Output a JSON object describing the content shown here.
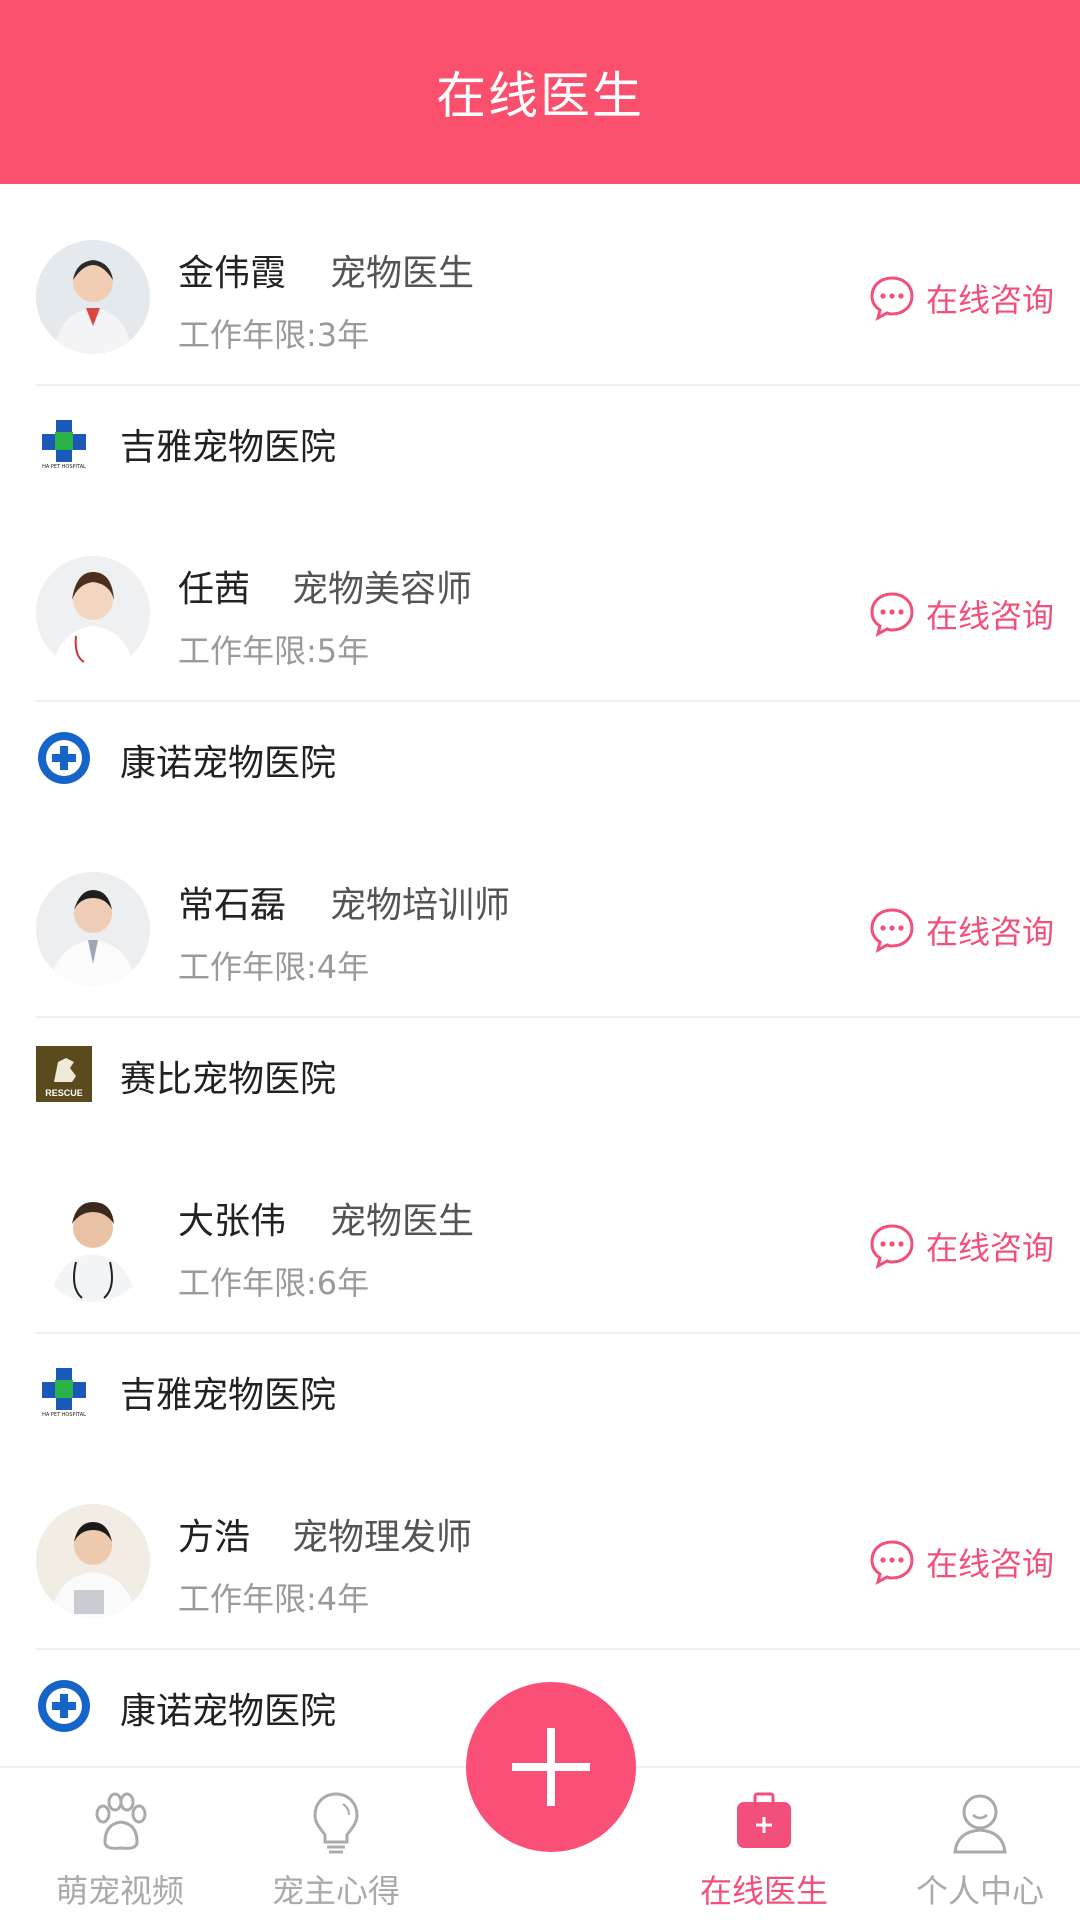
{
  "header": {
    "title": "在线医生"
  },
  "doctors": [
    {
      "name": "金伟霞",
      "role": "宠物医生",
      "years": "工作年限:3年",
      "consult_label": "在线咨询",
      "hospital": "吉雅宠物医院",
      "hospital_logo": "jiya-logo-icon"
    },
    {
      "name": "任茜",
      "role": "宠物美容师",
      "years": "工作年限:5年",
      "consult_label": "在线咨询",
      "hospital": "康诺宠物医院",
      "hospital_logo": "kangnuo-logo-icon"
    },
    {
      "name": "常石磊",
      "role": "宠物培训师",
      "years": "工作年限:4年",
      "consult_label": "在线咨询",
      "hospital": "赛比宠物医院",
      "hospital_logo": "rescue-logo-icon"
    },
    {
      "name": "大张伟",
      "role": "宠物医生",
      "years": "工作年限:6年",
      "consult_label": "在线咨询",
      "hospital": "吉雅宠物医院",
      "hospital_logo": "jiya-logo-icon"
    },
    {
      "name": "方浩",
      "role": "宠物理发师",
      "years": "工作年限:4年",
      "consult_label": "在线咨询",
      "hospital": "康诺宠物医院",
      "hospital_logo": "kangnuo-logo-icon"
    }
  ],
  "hospital_logo_text": {
    "jiya": "HA PET HOSPITAL",
    "rescue": "RESCUE"
  },
  "tabbar": {
    "tabs": [
      {
        "label": "萌宠视频",
        "icon": "paw-icon"
      },
      {
        "label": "宠主心得",
        "icon": "lightbulb-icon"
      },
      {
        "label": "在线医生",
        "icon": "medkit-icon",
        "active": true
      },
      {
        "label": "个人中心",
        "icon": "user-icon"
      }
    ],
    "fab_icon": "plus-icon"
  },
  "colors": {
    "accent": "#fa506e",
    "consult": "#f2507a",
    "tab_inactive": "#aaaaaa"
  }
}
